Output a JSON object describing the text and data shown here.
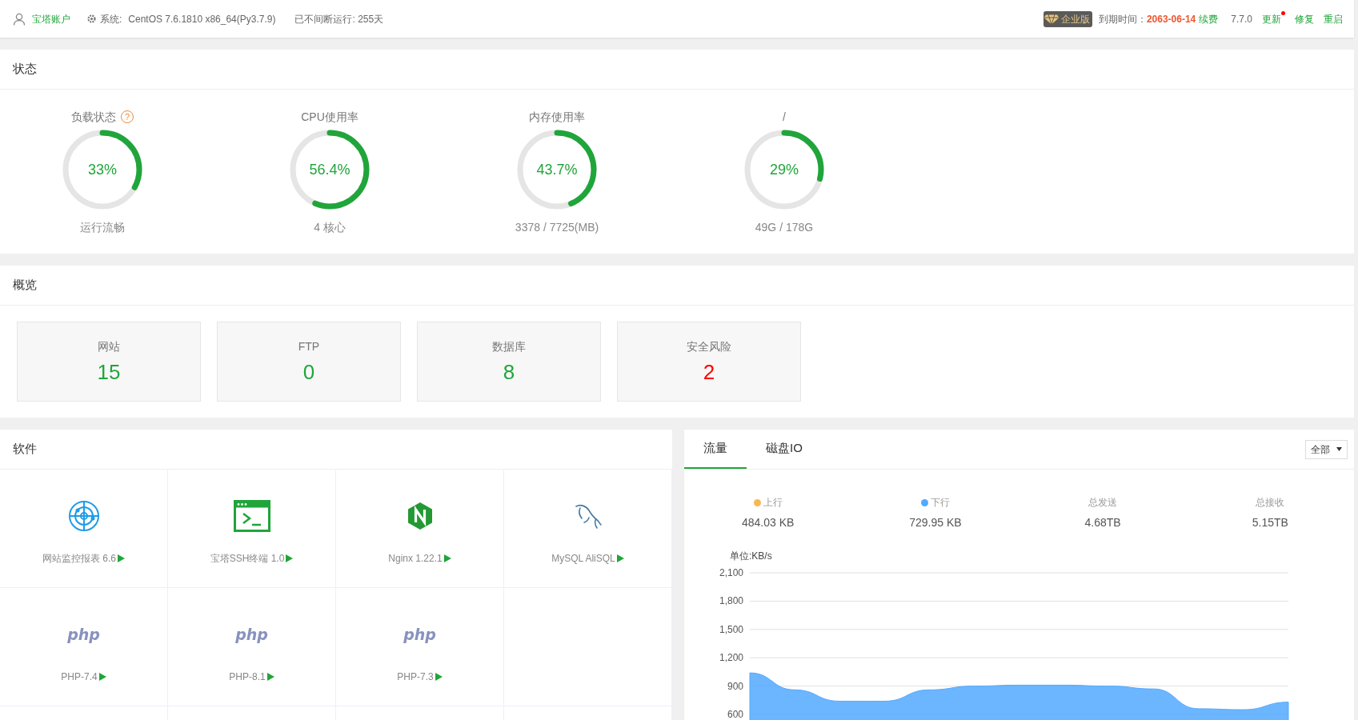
{
  "top_bar": {
    "account": "宝塔账户",
    "system_label": "系统:",
    "system": "CentOS 7.6.1810 x86_64(Py3.7.9)",
    "uptime": "已不间断运行: 255天",
    "edition": "企业版",
    "expiry_label": "到期时间：",
    "expiry_date": "2063-06-14",
    "renew": "续费",
    "version": "7.7.0",
    "actions": [
      {
        "label": "更新",
        "notify": true
      },
      {
        "label": "修复",
        "notify": false
      },
      {
        "label": "重启",
        "notify": false
      }
    ]
  },
  "status": {
    "title": "状态",
    "gauges": [
      {
        "label": "负载状态",
        "help": "?",
        "value": "33%",
        "level": 0.33,
        "detail": "运行流畅"
      },
      {
        "label": "CPU使用率",
        "value": "56.4%",
        "level": 0.564,
        "detail": "4 核心"
      },
      {
        "label": "内存使用率",
        "value": "43.7%",
        "level": 0.437,
        "detail": "3378 / 7725(MB)"
      },
      {
        "label": "/",
        "value": "29%",
        "level": 0.29,
        "detail": "49G / 178G"
      }
    ]
  },
  "overview": {
    "title": "概览",
    "cards": [
      {
        "label": "网站",
        "value": "15",
        "alert": false
      },
      {
        "label": "FTP",
        "value": "0",
        "alert": false
      },
      {
        "label": "数据库",
        "value": "8",
        "alert": false
      },
      {
        "label": "安全风险",
        "value": "2",
        "alert": true
      }
    ]
  },
  "software": {
    "title": "软件",
    "apps": [
      {
        "name": "网站监控报表 6.6",
        "kind": "radar"
      },
      {
        "name": "宝塔SSH终端 1.0",
        "kind": "terminal"
      },
      {
        "name": "Nginx 1.22.1",
        "kind": "nginx"
      },
      {
        "name": "MySQL AliSQL",
        "kind": "dolphin"
      },
      {
        "name": "PHP-7.4 ",
        "kind": "php",
        "logo": "php"
      },
      {
        "name": "PHP-8.1 ",
        "kind": "php",
        "logo": "php"
      },
      {
        "name": "PHP-7.3 ",
        "kind": "php",
        "logo": "php"
      }
    ]
  },
  "traffic": {
    "tabs": [
      {
        "label": "流量",
        "selected": true
      },
      {
        "label": "磁盘IO",
        "selected": false
      }
    ],
    "filter": "全部",
    "stats": [
      {
        "label": "上行",
        "value": "484.03 KB",
        "color": "#f7b851"
      },
      {
        "label": "下行",
        "value": "729.95 KB",
        "color": "#52a9ff"
      },
      {
        "label": "总发送",
        "value": "4.68TB"
      },
      {
        "label": "总接收",
        "value": "5.15TB"
      }
    ],
    "unit": "单位:KB/s",
    "chart_data": {
      "type": "area",
      "grid": true,
      "ylim": [
        600,
        2100
      ],
      "yticks": [
        {
          "value": 600,
          "label": "600"
        },
        {
          "value": 900,
          "label": "900"
        },
        {
          "value": 1200,
          "label": "1,200"
        },
        {
          "value": 1500,
          "label": "1,500"
        },
        {
          "value": 1800,
          "label": "1,800"
        },
        {
          "value": 2100,
          "label": "2,100"
        }
      ],
      "series": [
        {
          "color": "#52a9ff",
          "values": [
            1040,
            860,
            740,
            740,
            860,
            900,
            910,
            910,
            900,
            870,
            660,
            650,
            730
          ]
        }
      ]
    }
  }
}
